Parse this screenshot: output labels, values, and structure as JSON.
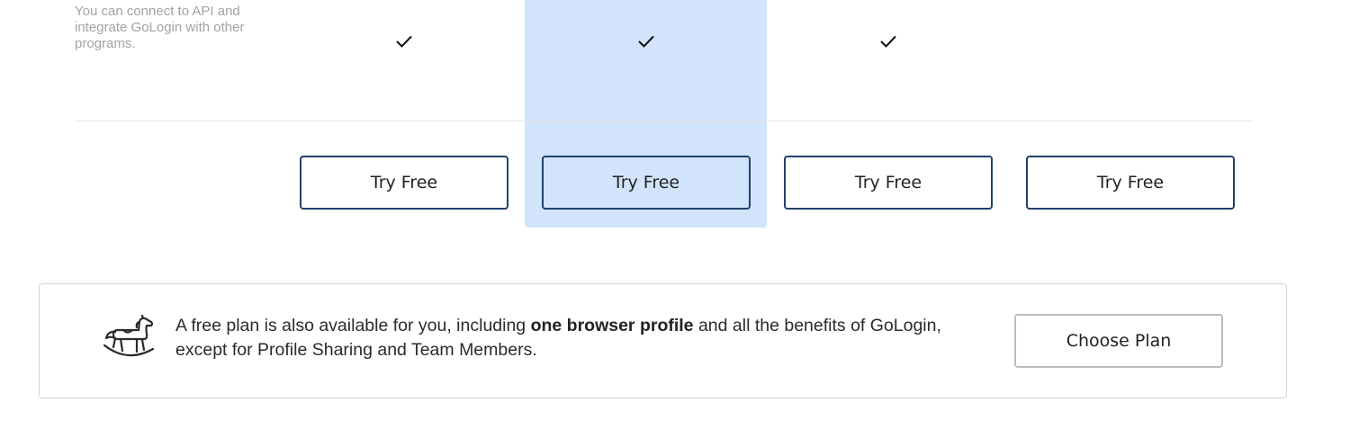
{
  "feature": {
    "description": "You can connect to API and integrate GoLogin with other programs."
  },
  "plans": [
    {
      "included": true,
      "button_label": "Try Free",
      "featured": false
    },
    {
      "included": true,
      "button_label": "Try Free",
      "featured": true
    },
    {
      "included": true,
      "button_label": "Try Free",
      "featured": false
    },
    {
      "included": false,
      "button_label": "Try Free",
      "featured": false
    }
  ],
  "icons": {
    "check": "checkmark-icon",
    "horse": "rocking-horse-icon"
  },
  "colors": {
    "featured_bg": "#d1e4fb",
    "button_border": "#21416e",
    "muted_text": "#a3a3a3"
  },
  "free_plan": {
    "text_before": "A free plan is also available for you, including ",
    "text_bold": "one browser profile",
    "text_after": " and all the benefits of GoLogin, except for Profile Sharing and Team Members.",
    "button_label": "Choose Plan"
  }
}
